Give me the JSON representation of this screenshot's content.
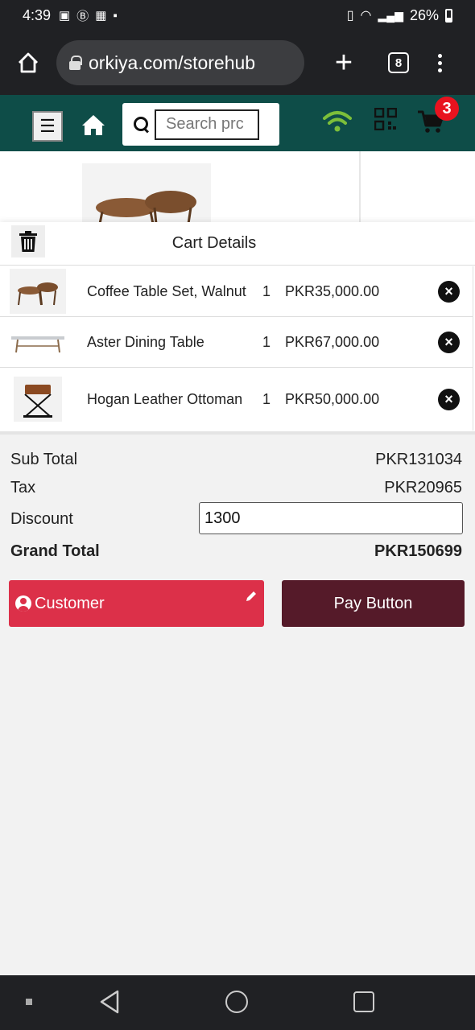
{
  "status_bar": {
    "time": "4:39",
    "battery": "26%"
  },
  "browser": {
    "url": "orkiya.com/storehub",
    "tab_count": "8"
  },
  "app_header": {
    "search_placeholder": "Search prc",
    "cart_count": "3",
    "colors": {
      "header_bg": "#0e4d48",
      "wifi": "#7cbf3a",
      "badge": "#e8131f"
    }
  },
  "cart": {
    "title": "Cart Details",
    "items": [
      {
        "name": "Coffee Table Set, Walnut",
        "qty": "1",
        "price": "PKR35,000.00"
      },
      {
        "name": "Aster Dining Table",
        "qty": "1",
        "price": "PKR67,000.00"
      },
      {
        "name": "Hogan Leather Ottoman",
        "qty": "1",
        "price": "PKR50,000.00"
      }
    ]
  },
  "totals": {
    "subtotal_label": "Sub Total",
    "subtotal_value": "PKR131034",
    "tax_label": "Tax",
    "tax_value": "PKR20965",
    "discount_label": "Discount",
    "discount_value": "1300",
    "grand_total_label": "Grand Total",
    "grand_total_value": "PKR150699"
  },
  "actions": {
    "customer_label": "Customer",
    "pay_label": "Pay Button",
    "colors": {
      "customer_bg": "#dc3049",
      "pay_bg": "#551a29"
    }
  }
}
